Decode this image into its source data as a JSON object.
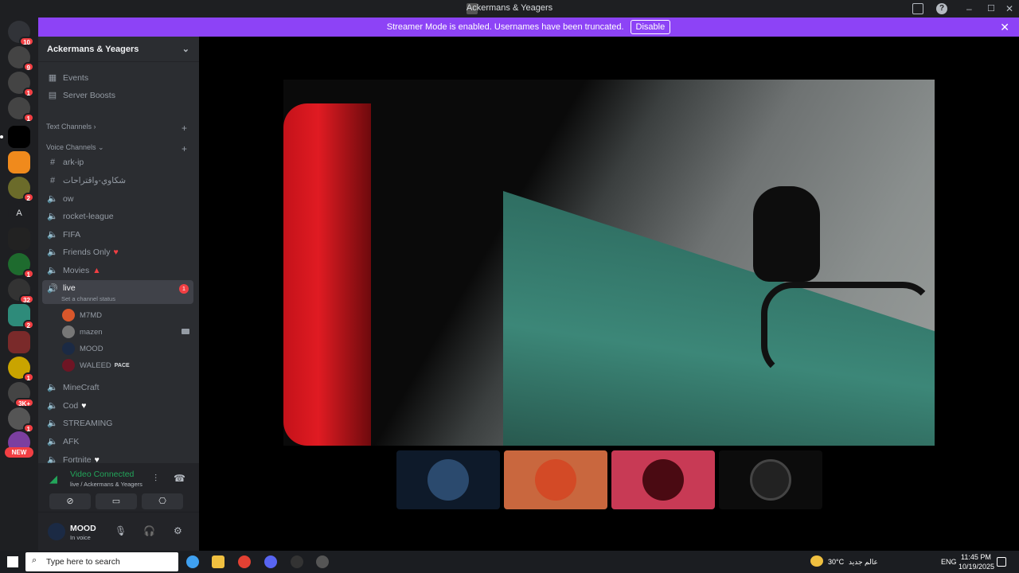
{
  "window": {
    "title": "Ackermans & Yeagers"
  },
  "banner": {
    "text": "Streamer Mode is enabled. Usernames have been truncated.",
    "disable_label": "Disable"
  },
  "servers": {
    "badges": [
      "10",
      "9",
      "1",
      "1",
      "2",
      "1",
      "32",
      "2",
      "1",
      "3K+",
      "1"
    ],
    "letter": "A",
    "new_label": "NEW"
  },
  "sidebar": {
    "server_name": "Ackermans & Yeagers",
    "top_items": [
      {
        "label": "Events"
      },
      {
        "label": "Server Boosts"
      }
    ],
    "cat_text": "Text Channels",
    "cat_voice": "Voice Channels",
    "channels": [
      {
        "label": "ark-ip"
      },
      {
        "label": "شكاوي-واقتراحات"
      },
      {
        "label": "ow"
      },
      {
        "label": "rocket-league"
      },
      {
        "label": "FIFA"
      },
      {
        "label": "Friends Only"
      },
      {
        "label": "Movies"
      },
      {
        "label": "live",
        "status": "Set a channel status",
        "count": "1"
      },
      {
        "label": "MineCraft"
      },
      {
        "label": "Cod"
      },
      {
        "label": "STREAMING"
      },
      {
        "label": "AFK"
      },
      {
        "label": "Fortnite"
      }
    ],
    "members": [
      {
        "name": "M7MD"
      },
      {
        "name": "mazen"
      },
      {
        "name": "MOOD"
      },
      {
        "name": "WALEED",
        "tag": "PACE"
      }
    ]
  },
  "voice": {
    "title": "Video Connected",
    "subtitle": "live / Ackermans & Yeagers"
  },
  "user": {
    "name": "MOOD",
    "status": "In voice"
  },
  "taskbar": {
    "search_placeholder": "Type here to search",
    "weather": "30°C",
    "weather_note": "عالم جديد",
    "lang": "ENG",
    "time": "11:45 PM",
    "date": "10/19/2025"
  },
  "colors": {
    "accent": "#8d43f6",
    "online": "#23a55a",
    "badge": "#f23f43"
  }
}
